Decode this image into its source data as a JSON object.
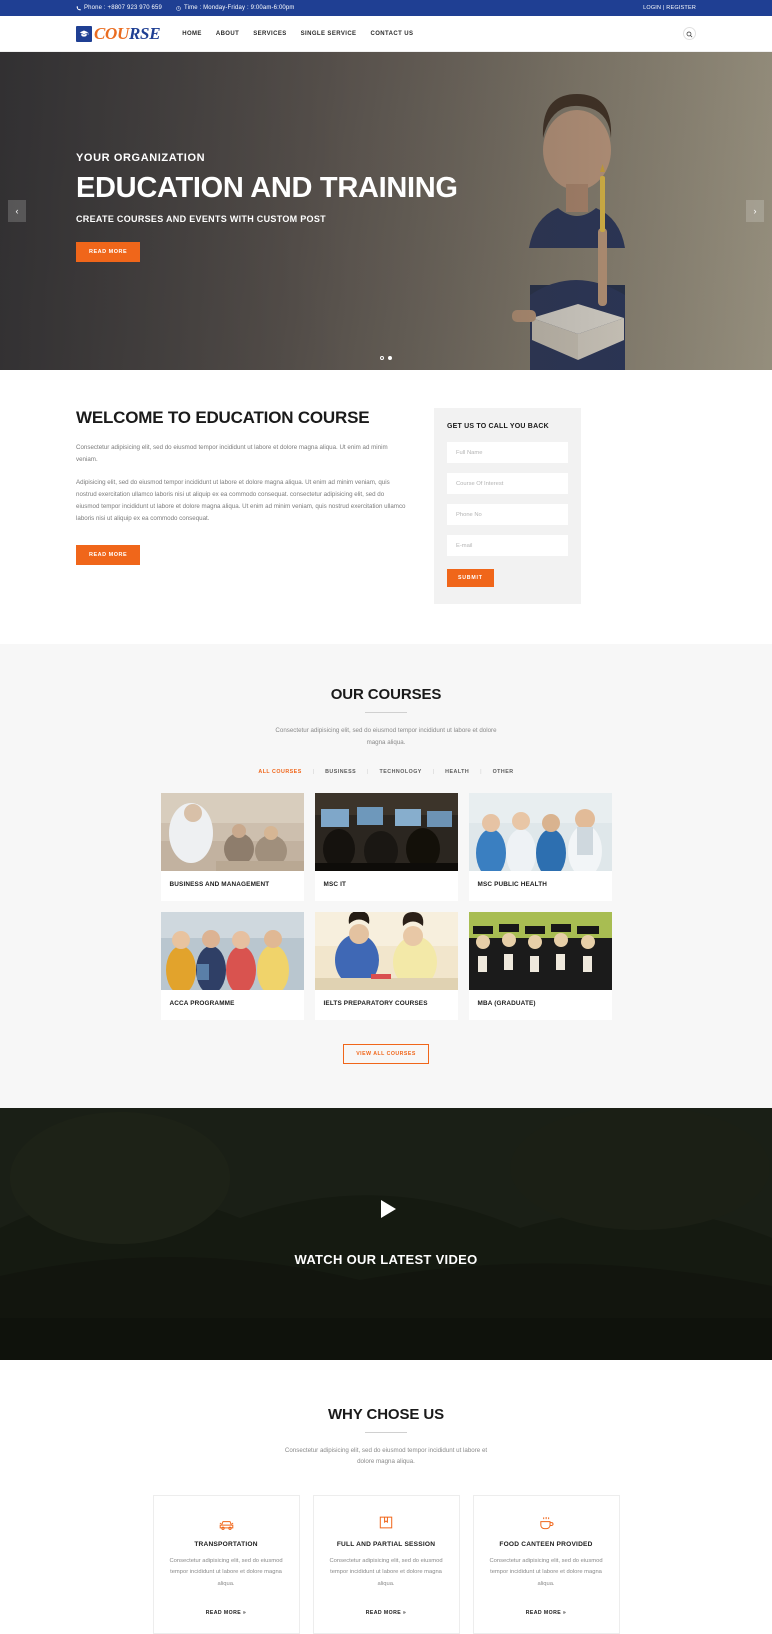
{
  "topbar": {
    "phone_icon": "phone-icon",
    "phone": "Phone : +8807 923 970 659",
    "time_icon": "clock-icon",
    "time": "Time : Monday-Friday : 9:00am-6:00pm",
    "account": "LOGIN | REGISTER"
  },
  "header": {
    "logo_icon": "graduation-cap-icon",
    "logo_part1": "COU",
    "logo_part2": "RSE",
    "nav": [
      {
        "label": "HOME"
      },
      {
        "label": "ABOUT"
      },
      {
        "label": "SERVICES"
      },
      {
        "label": "SINGLE SERVICE"
      },
      {
        "label": "CONTACT US"
      }
    ],
    "search_icon": "search-icon"
  },
  "hero": {
    "prev_icon": "chevron-left-icon",
    "next_icon": "chevron-right-icon",
    "kicker": "YOUR ORGANIZATION",
    "title": "EDUCATION AND TRAINING",
    "subtitle": "CREATE COURSES AND EVENTS WITH CUSTOM POST",
    "cta": "READ MORE",
    "slides": 2,
    "active_slide": 2
  },
  "welcome": {
    "title": "WELCOME TO EDUCATION COURSE",
    "p1": "Consectetur adipisicing elit, sed do eiusmod tempor incididunt ut labore et dolore magna aliqua. Ut enim ad minim veniam.",
    "p2": "Adipisicing elit, sed do eiusmod tempor incididunt ut labore et dolore magna aliqua. Ut enim ad minim veniam, quis nostrud exercitation ullamco laboris nisi ut aliquip ex ea commodo consequat. consectetur adipisicing elit, sed do eiusmod tempor incididunt ut labore et dolore magna aliqua. Ut enim ad minim veniam, quis nostrud exercitation ullamco laboris nisi ut aliquip ex ea commodo consequat.",
    "cta": "READ MORE"
  },
  "callback": {
    "title": "GET US TO CALL YOU BACK",
    "fields": [
      {
        "name": "full-name",
        "placeholder": "Full Name",
        "value": ""
      },
      {
        "name": "course-of-interest",
        "placeholder": "Course Of Interest",
        "value": ""
      },
      {
        "name": "phone-no",
        "placeholder": "Phone No",
        "value": ""
      },
      {
        "name": "email",
        "placeholder": "E-mail",
        "value": ""
      }
    ],
    "submit": "SUBMIT"
  },
  "courses": {
    "title": "OUR COURSES",
    "desc": "Consectetur adipisicing elit, sed do eiusmod tempor incididunt ut labore et dolore magna aliqua.",
    "filters": [
      {
        "label": "ALL COURSES",
        "active": true
      },
      {
        "label": "BUSINESS",
        "active": false
      },
      {
        "label": "TECHNOLOGY",
        "active": false
      },
      {
        "label": "HEALTH",
        "active": false
      },
      {
        "label": "OTHER",
        "active": false
      }
    ],
    "items": [
      {
        "title": "BUSINESS AND MANAGEMENT",
        "image": "classroom-discussion-photo"
      },
      {
        "title": "MSC IT",
        "image": "computer-lab-photo"
      },
      {
        "title": "MSC PUBLIC HEALTH",
        "image": "medical-team-photo"
      },
      {
        "title": "ACCA PROGRAMME",
        "image": "students-group-photo"
      },
      {
        "title": "IELTS PREPARATORY COURSES",
        "image": "students-studying-photo"
      },
      {
        "title": "MBA (GRADUATE)",
        "image": "graduates-photo"
      }
    ],
    "view_all": "VIEW ALL COURSES"
  },
  "video": {
    "play_icon": "play-icon",
    "title": "WATCH OUR LATEST VIDEO"
  },
  "why": {
    "title": "WHY CHOSE US",
    "desc": "Consectetur adipisicing elit, sed do eiusmod tempor incididunt ut labore et dolore magna aliqua.",
    "features": [
      {
        "icon": "car-icon",
        "title": "TRANSPORTATION",
        "desc": "Consectetur adipisicing elit, sed do eiusmod tempor incididunt ut labore et dolore magna aliqua.",
        "more": "READ MORE »"
      },
      {
        "icon": "book-icon",
        "title": "FULL AND PARTIAL SESSION",
        "desc": "Consectetur adipisicing elit, sed do eiusmod tempor incididunt ut labore et dolore magna aliqua.",
        "more": "READ MORE »"
      },
      {
        "icon": "coffee-cup-icon",
        "title": "FOOD CANTEEN PROVIDED",
        "desc": "Consectetur adipisicing elit, sed do eiusmod tempor incididunt ut labore et dolore magna aliqua.",
        "more": "READ MORE »"
      }
    ]
  },
  "colors": {
    "brand_blue": "#1f3f93",
    "accent_orange": "#f0661a",
    "section_bg": "#f7f7f7",
    "form_bg": "#f2f2f2"
  }
}
